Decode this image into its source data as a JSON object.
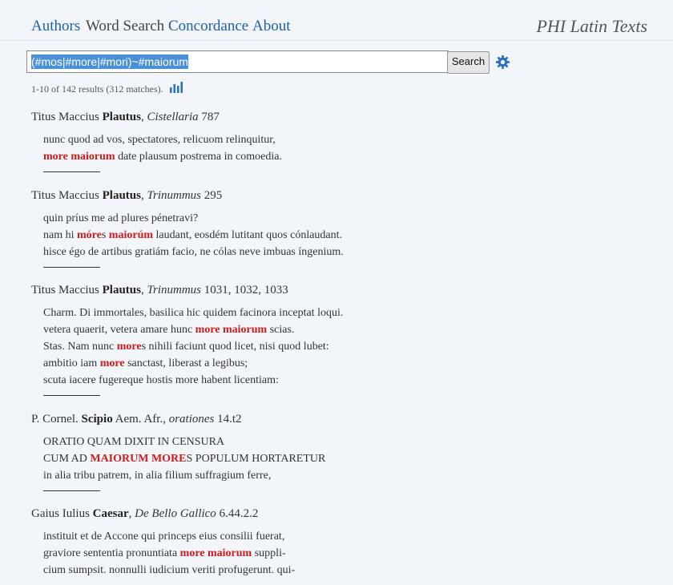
{
  "nav": {
    "authors": "Authors",
    "word_search": "Word Search",
    "concordance": "Concordance",
    "about": "About",
    "brand": "PHI Latin Texts"
  },
  "search": {
    "query": "(#mos|#more|#mori)~#maiorum",
    "button_label": "Search"
  },
  "summary": "1-10 of 142 results (312 matches).",
  "results": [
    {
      "cite_pre": "Titus Maccius ",
      "author": "Plautus",
      "sep": ", ",
      "work": "Cistellaria",
      "loc": " 787",
      "lines": [
        [
          {
            "t": "nunc quod ad vos, spectatores, relicuom relinquitur,"
          }
        ],
        [
          {
            "t": "more maiorum",
            "h": true
          },
          {
            "t": " date plausum postrema in comoedia."
          }
        ]
      ]
    },
    {
      "cite_pre": "Titus Maccius ",
      "author": "Plautus",
      "sep": ", ",
      "work": "Trinummus",
      "loc": " 295",
      "lines": [
        [
          {
            "t": "quin príus me ad plures pénetravi?"
          }
        ],
        [
          {
            "t": "nam hi "
          },
          {
            "t": "móre",
            "h": true
          },
          {
            "t": "s "
          },
          {
            "t": "maiorúm",
            "h": true
          },
          {
            "t": " laudant, eosdém lutitant quos cónlaudant."
          }
        ],
        [
          {
            "t": "hisce égo de artibus gratiám facio, ne cólas neve imbuas íngenium."
          }
        ]
      ]
    },
    {
      "cite_pre": "Titus Maccius ",
      "author": "Plautus",
      "sep": ", ",
      "work": "Trinummus",
      "loc": " 1031, 1032, 1033",
      "lines": [
        [
          {
            "t": "Charm. Di immortales, basilica hic quidem facinora inceptat loqui."
          }
        ],
        [
          {
            "t": "vetera quaerit, vetera amare hunc "
          },
          {
            "t": "more maiorum",
            "h": true
          },
          {
            "t": " scias."
          }
        ],
        [
          {
            "t": "Stas. Nam nunc "
          },
          {
            "t": "more",
            "h": true
          },
          {
            "t": "s nihili faciunt quod licet, nisi quod lubet:"
          }
        ],
        [
          {
            "t": "ambitio iam "
          },
          {
            "t": "more",
            "h": true
          },
          {
            "t": " sanctast, liberast a legibus;"
          }
        ],
        [
          {
            "t": "scuta iacere fugereque hostis more habent licentiam:"
          }
        ]
      ]
    },
    {
      "cite_pre": "P. Cornel. ",
      "author": "Scipio",
      "sep": " Aem. Afr., ",
      "work": "orationes",
      "loc": " 14.t2",
      "lines": [
        [
          {
            "t": "ORATIO QUAM DIXIT IN CENSURA"
          }
        ],
        [
          {
            "t": "CUM AD "
          },
          {
            "t": "MAIORUM MORE",
            "h": true
          },
          {
            "t": "S POPULUM HORTARETUR"
          }
        ],
        [
          {
            "t": "in alia tribu patrem, in alia filium suffragium ferre,"
          }
        ]
      ]
    },
    {
      "cite_pre": "Gaius Iulius ",
      "author": "Caesar",
      "sep": ", ",
      "work": "De Bello Gallico",
      "loc": " 6.44.2.2",
      "lines": [
        [
          {
            "t": "instituit et de Accone qui princeps eius consilii fuerat,"
          }
        ],
        [
          {
            "t": "graviore sententia pronuntiata "
          },
          {
            "t": "more maiorum",
            "h": true
          },
          {
            "t": " suppli-"
          }
        ],
        [
          {
            "t": "cium sumpsit. nonnulli iudicium veriti profugerunt. qui-"
          }
        ]
      ]
    }
  ]
}
